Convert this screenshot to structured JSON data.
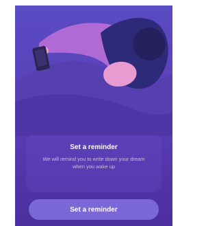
{
  "onboarding": {
    "title": "Set a reminder",
    "description": "We will remind you to write down your dream when you wake up",
    "cta_label": "Set a reminder"
  },
  "colors": {
    "background_top": "#5a4cc3",
    "background_bottom": "#4b2f9e",
    "button": "#7b67d6"
  },
  "illustration": {
    "name": "sleeping-person-with-phone"
  }
}
